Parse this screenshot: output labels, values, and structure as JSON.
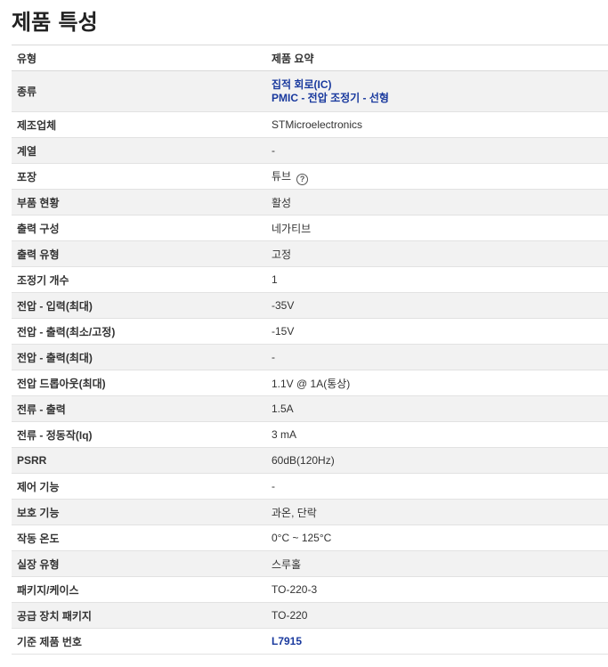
{
  "title": "제품 특성",
  "header": {
    "type": "유형",
    "summary": "제품 요약"
  },
  "rows": [
    {
      "label": "종류",
      "links": [
        "집적 회로(IC)",
        "PMIC - 전압 조정기 - 선형"
      ]
    },
    {
      "label": "제조업체",
      "value": "STMicroelectronics"
    },
    {
      "label": "계열",
      "value": "-"
    },
    {
      "label": "포장",
      "value": "튜브",
      "help": "?"
    },
    {
      "label": "부품 현황",
      "value": "활성"
    },
    {
      "label": "출력 구성",
      "value": "네가티브"
    },
    {
      "label": "출력 유형",
      "value": "고정"
    },
    {
      "label": "조정기 개수",
      "value": "1"
    },
    {
      "label": "전압 - 입력(최대)",
      "value": "-35V"
    },
    {
      "label": "전압 - 출력(최소/고정)",
      "value": "-15V"
    },
    {
      "label": "전압 - 출력(최대)",
      "value": "-"
    },
    {
      "label": "전압 드롭아웃(최대)",
      "value": "1.1V @ 1A(통상)"
    },
    {
      "label": "전류 - 출력",
      "value": "1.5A"
    },
    {
      "label": "전류 - 정동작(Iq)",
      "value": "3 mA"
    },
    {
      "label": "PSRR",
      "value": "60dB(120Hz)"
    },
    {
      "label": "제어 기능",
      "value": "-"
    },
    {
      "label": "보호 기능",
      "value": "과온, 단락"
    },
    {
      "label": "작동 온도",
      "value": "0°C ~ 125°C"
    },
    {
      "label": "실장 유형",
      "value": "스루홀"
    },
    {
      "label": "패키지/케이스",
      "value": "TO-220-3"
    },
    {
      "label": "공급 장치 패키지",
      "value": "TO-220"
    },
    {
      "label": "기준 제품 번호",
      "link": "L7915"
    }
  ],
  "colors": {
    "link": "#1a3a9e",
    "stripe": "#f2f2f2",
    "border": "#e2e2e2"
  }
}
